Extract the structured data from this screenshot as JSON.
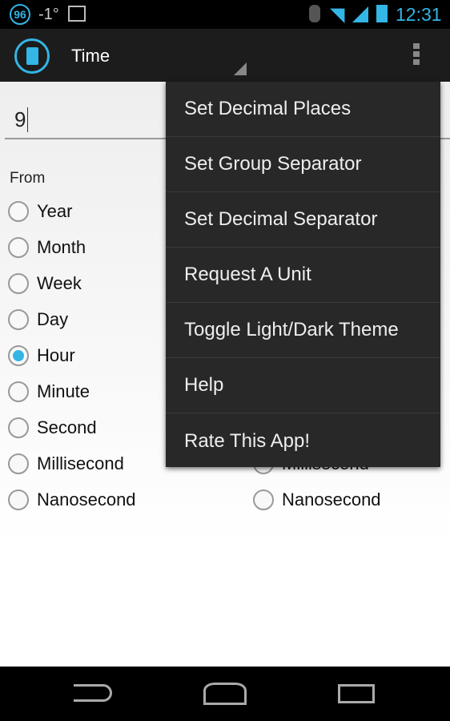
{
  "status": {
    "notif_badge": "96",
    "temperature": "-1°",
    "time": "12:31",
    "accent": "#33b5e5"
  },
  "actionbar": {
    "title": "Time",
    "overflow_icon": "overflow-menu-icon",
    "app_icon": "calculator-icon"
  },
  "input": {
    "value": "9"
  },
  "from": {
    "label": "From",
    "options": [
      "Year",
      "Month",
      "Week",
      "Day",
      "Hour",
      "Minute",
      "Second",
      "Millisecond",
      "Nanosecond"
    ],
    "selected": "Hour"
  },
  "to": {
    "options": [
      "Millisecond",
      "Nanosecond"
    ]
  },
  "menu": {
    "items": [
      "Set Decimal Places",
      "Set Group Separator",
      "Set Decimal Separator",
      "Request A Unit",
      "Toggle Light/Dark Theme",
      "Help",
      "Rate This App!"
    ]
  }
}
